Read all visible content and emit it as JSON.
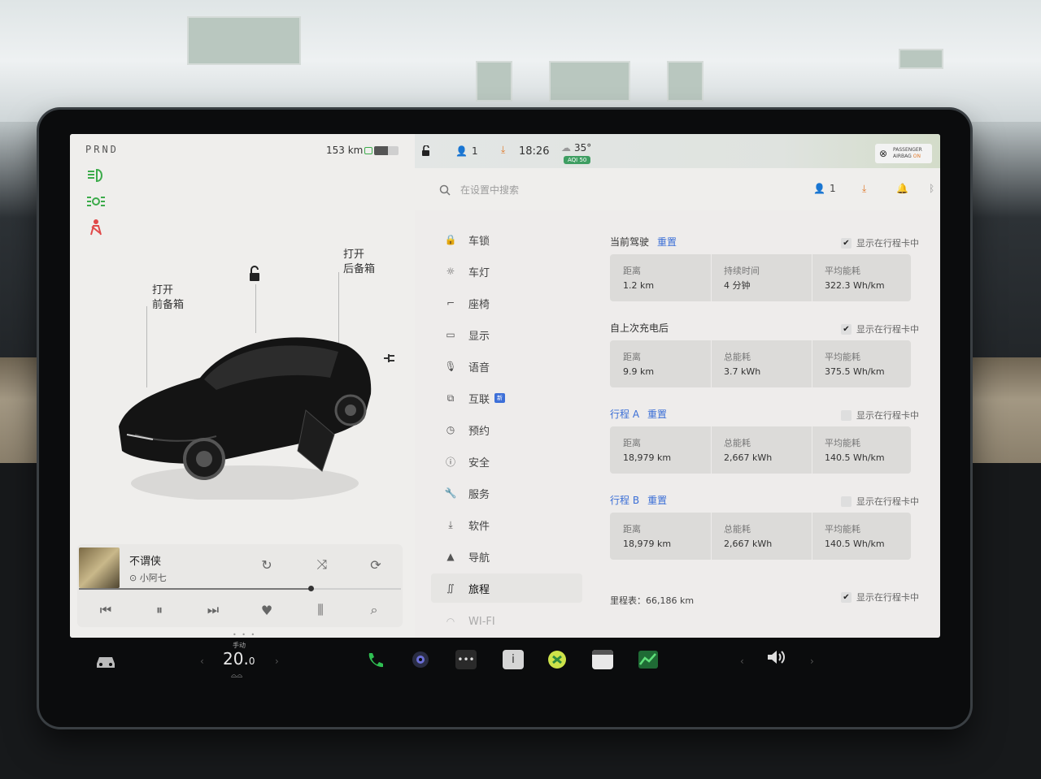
{
  "vehicle": {
    "gear": "PRND",
    "range": "153 km",
    "battery_level": 0.55,
    "frunk": {
      "line1": "打开",
      "line2": "前备箱"
    },
    "trunk": {
      "line1": "打开",
      "line2": "后备箱"
    }
  },
  "media": {
    "song": "不谓侠",
    "artist": "小阿七",
    "progress": 0.72,
    "page_dots": "• • •"
  },
  "status_bar": {
    "lock_icon": "lock-open-icon",
    "profile_count": "1",
    "time": "18:26",
    "temperature": "35°",
    "aqi": "AQI 50",
    "airbag_line1": "PASSENGER",
    "airbag_line2": "AIRBAG",
    "airbag_state": "ON"
  },
  "settings_header": {
    "search_placeholder": "在设置中搜索",
    "profile_count": "1"
  },
  "nav": {
    "items": [
      {
        "label": "车锁",
        "icon": "lock-icon"
      },
      {
        "label": "车灯",
        "icon": "light-icon"
      },
      {
        "label": "座椅",
        "icon": "seat-icon"
      },
      {
        "label": "显示",
        "icon": "display-icon"
      },
      {
        "label": "语音",
        "icon": "mic-icon"
      },
      {
        "label": "互联",
        "icon": "connectivity-icon",
        "badge": "新"
      },
      {
        "label": "预约",
        "icon": "clock-icon"
      },
      {
        "label": "安全",
        "icon": "safety-icon"
      },
      {
        "label": "服务",
        "icon": "wrench-icon"
      },
      {
        "label": "软件",
        "icon": "download-icon"
      },
      {
        "label": "导航",
        "icon": "navigation-icon"
      },
      {
        "label": "旅程",
        "icon": "trips-icon",
        "active": true
      },
      {
        "label": "WI-FI",
        "icon": "wifi-icon"
      }
    ]
  },
  "trips": {
    "show_label": "显示在行程卡中",
    "reset_label": "重置",
    "current": {
      "title": "当前驾驶",
      "checked": true,
      "cells": [
        {
          "label": "距离",
          "value": "1.2 km"
        },
        {
          "label": "持续时间",
          "value": "4 分钟"
        },
        {
          "label": "平均能耗",
          "value": "322.3 Wh/km"
        }
      ]
    },
    "since_charge": {
      "title": "自上次充电后",
      "checked": true,
      "cells": [
        {
          "label": "距离",
          "value": "9.9 km"
        },
        {
          "label": "总能耗",
          "value": "3.7 kWh"
        },
        {
          "label": "平均能耗",
          "value": "375.5 Wh/km"
        }
      ]
    },
    "trip_a": {
      "title": "行程 A",
      "checked": false,
      "cells": [
        {
          "label": "距离",
          "value": "18,979 km"
        },
        {
          "label": "总能耗",
          "value": "2,667 kWh"
        },
        {
          "label": "平均能耗",
          "value": "140.5 Wh/km"
        }
      ]
    },
    "trip_b": {
      "title": "行程 B",
      "checked": false,
      "cells": [
        {
          "label": "距离",
          "value": "18,979 km"
        },
        {
          "label": "总能耗",
          "value": "2,667 kWh"
        },
        {
          "label": "平均能耗",
          "value": "140.5 Wh/km"
        }
      ]
    },
    "odometer": "里程表：66,186 km",
    "odometer_checked": true
  },
  "bottom_bar": {
    "climate_mode": "手动",
    "temp_whole": "20.",
    "temp_decimal": "0",
    "apps": [
      "car-icon",
      "phone-icon",
      "camera-icon",
      "more-icon",
      "manual-icon",
      "toybox-icon",
      "calendar-icon",
      "energy-icon",
      "volume-icon"
    ]
  },
  "colors": {
    "accent_blue": "#3a6ed6",
    "screen_bg": "#eeeceb",
    "card_bg": "#dcdbd9",
    "status_green": "#3cab4b"
  }
}
